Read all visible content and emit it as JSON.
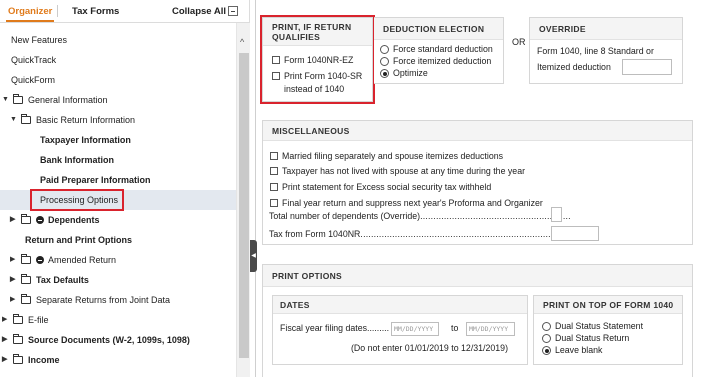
{
  "tabs": {
    "organizer": "Organizer",
    "tax_forms": "Tax Forms",
    "collapse_all": "Collapse All"
  },
  "tree": [
    {
      "label": "New Features",
      "level": 0,
      "caret": "",
      "icon": "",
      "bold": false,
      "selected": false
    },
    {
      "label": "QuickTrack",
      "level": 0,
      "caret": "",
      "icon": "",
      "bold": false,
      "selected": false
    },
    {
      "label": "QuickForm",
      "level": 0,
      "caret": "",
      "icon": "",
      "bold": false,
      "selected": false
    },
    {
      "label": "General Information",
      "level": 0,
      "caret": "down",
      "icon": "folder",
      "bold": false,
      "selected": false
    },
    {
      "label": "Basic Return Information",
      "level": 1,
      "caret": "down",
      "icon": "folder",
      "bold": false,
      "selected": false
    },
    {
      "label": "Taxpayer Information",
      "level": 2,
      "caret": "",
      "icon": "",
      "bold": true,
      "selected": false
    },
    {
      "label": "Bank Information",
      "level": 2,
      "caret": "",
      "icon": "",
      "bold": true,
      "selected": false
    },
    {
      "label": "Paid Preparer Information",
      "level": 2,
      "caret": "",
      "icon": "",
      "bold": true,
      "selected": false
    },
    {
      "label": "Processing Options",
      "level": 2,
      "caret": "",
      "icon": "",
      "bold": false,
      "selected": true
    },
    {
      "label": "Dependents",
      "level": 1,
      "caret": "right",
      "icon": "folder-dot",
      "bold": true,
      "selected": false
    },
    {
      "label": "Return and Print Options",
      "level": 1,
      "caret": "",
      "icon": "",
      "bold": true,
      "selected": false
    },
    {
      "label": "Amended Return",
      "level": 1,
      "caret": "right",
      "icon": "folder-dot",
      "bold": false,
      "selected": false
    },
    {
      "label": "Tax Defaults",
      "level": 1,
      "caret": "right",
      "icon": "folder",
      "bold": true,
      "selected": false
    },
    {
      "label": "Separate Returns from Joint Data",
      "level": 1,
      "caret": "right",
      "icon": "folder",
      "bold": false,
      "selected": false
    },
    {
      "label": "E-file",
      "level": 0,
      "caret": "right",
      "icon": "folder",
      "bold": false,
      "selected": false
    },
    {
      "label": "Source Documents (W-2, 1099s, 1098)",
      "level": 0,
      "caret": "right",
      "icon": "folder",
      "bold": true,
      "selected": false
    },
    {
      "label": "Income",
      "level": 0,
      "caret": "right",
      "icon": "folder",
      "bold": true,
      "selected": false
    }
  ],
  "print_if": {
    "title": "PRINT, IF RETURN QUALIFIES",
    "opt1": "Form 1040NR-EZ",
    "opt2_line1": "Print Form 1040-SR",
    "opt2_line2": "instead of 1040"
  },
  "deduction": {
    "title": "DEDUCTION ELECTION",
    "opt1": "Force standard deduction",
    "opt2": "Force itemized deduction",
    "opt3": "Optimize",
    "selected": "Optimize"
  },
  "or_label": "OR",
  "override": {
    "title": "OVERRIDE",
    "line1": "Form 1040, line 8 Standard or",
    "line2": "Itemized deduction",
    "value": ""
  },
  "misc": {
    "title": "MISCELLANEOUS",
    "chk1": "Married filing separately and spouse itemizes deductions",
    "chk2": "Taxpayer has not lived with spouse at any time during the year",
    "chk3": "Print statement for Excess social security tax withheld",
    "chk4": "Final year return and suppress next year's Proforma and Organizer",
    "dependents_label": "Total number of dependents (Override)",
    "dependents_value": "",
    "tax_label": "Tax from Form 1040NR",
    "tax_value": ""
  },
  "print_options": {
    "title": "PRINT OPTIONS",
    "dates_title": "DATES",
    "fiscal_label": "Fiscal year filing dates",
    "from_placeholder": "MM/DD/YYYY",
    "to_label": "to",
    "to_placeholder": "MM/DD/YYYY",
    "note": "(Do not enter 01/01/2019 to 12/31/2019)",
    "top_title": "PRINT ON TOP OF FORM 1040",
    "top_opt1": "Dual Status Statement",
    "top_opt2": "Dual Status Return",
    "top_opt3": "Leave blank",
    "top_selected": "Leave blank"
  }
}
